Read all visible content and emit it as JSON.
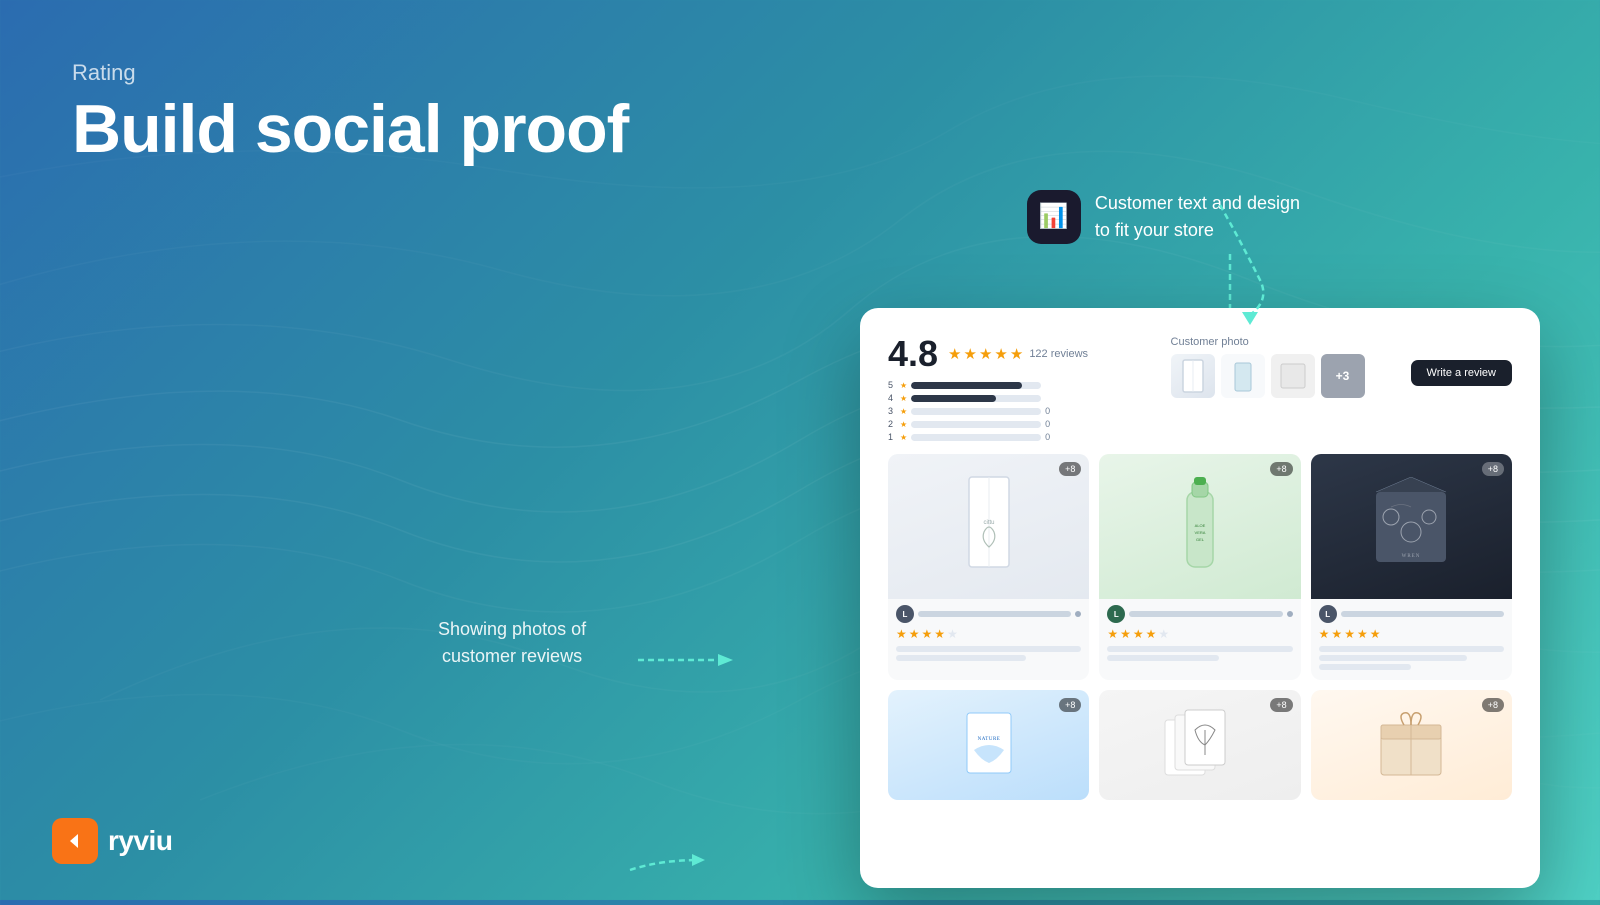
{
  "background": {
    "gradient_start": "#2b6cb0",
    "gradient_mid": "#2c8fa5",
    "gradient_end": "#4fd1c5"
  },
  "header": {
    "rating_label": "Rating",
    "main_title": "Build social proof"
  },
  "annotation_top_right": {
    "text_line1": "Customer text and design",
    "text_line2": "to fit your store",
    "icon": "📊"
  },
  "annotation_bottom_left": {
    "text_line1": "Showing photos of",
    "text_line2": "customer reviews"
  },
  "logo": {
    "text": "ryviu",
    "icon": "❮"
  },
  "screenshot": {
    "rating_number": "4.8",
    "stars": "★★★★★",
    "reviews_count": "122 reviews",
    "bars": [
      {
        "num": "5",
        "fill": 85,
        "count": ""
      },
      {
        "num": "4",
        "fill": 70,
        "count": ""
      },
      {
        "num": "3",
        "fill": 0,
        "count": "0"
      },
      {
        "num": "2",
        "fill": 0,
        "count": "0"
      },
      {
        "num": "1",
        "fill": 0,
        "count": "0"
      }
    ],
    "customer_photos_label": "Customer photo",
    "write_review_btn": "Write a review",
    "photo_badge": "+8",
    "photo_badge_2": "+8",
    "photo_badge_3": "+8"
  }
}
